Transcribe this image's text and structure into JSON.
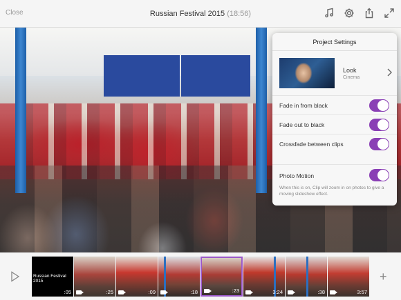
{
  "header": {
    "close_label": "Close",
    "title": "Russian Festival 2015",
    "duration": "(18:56)",
    "icons": [
      "music-icon",
      "gear-icon",
      "share-icon",
      "expand-icon"
    ]
  },
  "settings": {
    "title": "Project Settings",
    "look_label": "Look",
    "look_value": "Cinema",
    "fade_in_label": "Fade in from black",
    "fade_in_on": true,
    "fade_out_label": "Fade out to black",
    "fade_out_on": true,
    "crossfade_label": "Crossfade between clips",
    "crossfade_on": true,
    "photo_motion_label": "Photo Motion",
    "photo_motion_on": true,
    "photo_motion_desc": "When this is on, Clip will zoom in on photos to give a moving slideshow effect.",
    "accent_color": "#8a3fb5"
  },
  "timeline": {
    "clips": [
      {
        "title": "Russian Festival 2015",
        "duration": ":05",
        "type": "title"
      },
      {
        "duration": ":25",
        "type": "video"
      },
      {
        "duration": ":09",
        "type": "video"
      },
      {
        "duration": ":18",
        "type": "video"
      },
      {
        "duration": ":23",
        "type": "video",
        "selected": true
      },
      {
        "duration": "3:24",
        "type": "video"
      },
      {
        "duration": ":38",
        "type": "video"
      },
      {
        "duration": "3:57",
        "type": "video"
      }
    ],
    "remove_glyph": "×"
  }
}
